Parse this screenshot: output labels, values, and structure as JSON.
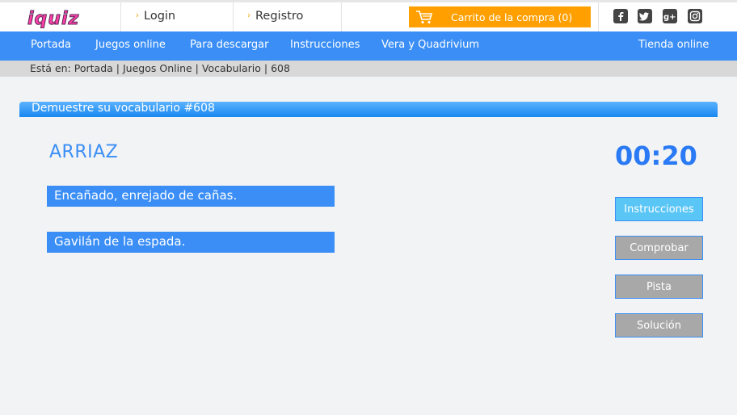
{
  "header": {
    "logo_text": "iquiz",
    "login_label": "Login",
    "register_label": "Registro",
    "cart_label": "Carrito de la compra (0)",
    "social_icons": [
      "facebook-icon",
      "twitter-icon",
      "googleplus-icon",
      "instagram-icon"
    ]
  },
  "nav": {
    "items": [
      "Portada",
      "Juegos online",
      "Para descargar",
      "Instrucciones",
      "Vera y Quadrivium"
    ],
    "store_label": "Tienda online"
  },
  "breadcrumb": {
    "prefix": "Está en:",
    "items": [
      "Portada",
      "Juegos Online",
      "Vocabulario",
      "608"
    ],
    "separator": "|"
  },
  "game": {
    "title": "Demuestre su vocabulario #608",
    "word": "ARRIAZ",
    "timer": "00:20",
    "options": [
      "Encañado, enrejado de cañas.",
      "Gavilán de la espada."
    ]
  },
  "buttons": {
    "instructions": "Instrucciones",
    "check": "Comprobar",
    "hint": "Pista",
    "solution": "Solución"
  },
  "colors": {
    "accent": "#3a8ef6",
    "cart": "#ffa000",
    "logo_pink": "#ff3fa4",
    "active_button": "#5ac6f6",
    "inactive_button": "#a8a8a8"
  }
}
